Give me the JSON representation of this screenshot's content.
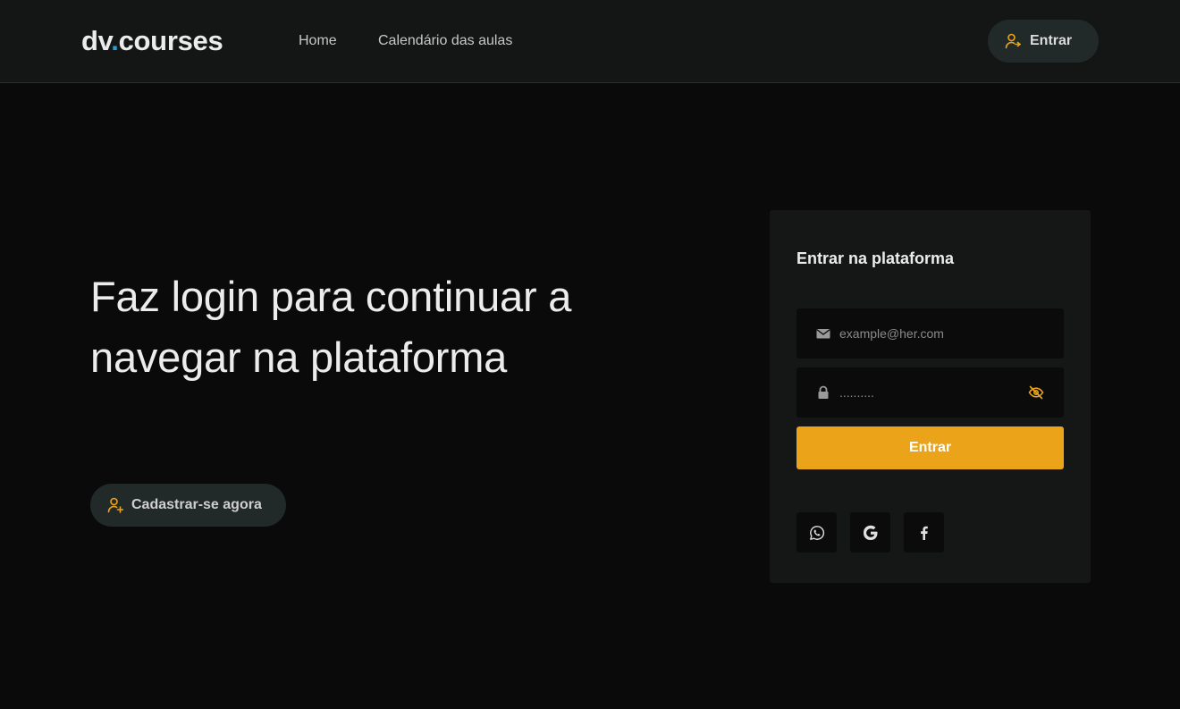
{
  "brand": {
    "name_part1": "dv",
    "name_dot": ".",
    "name_part2": "courses"
  },
  "nav": {
    "items": [
      {
        "label": "Home"
      },
      {
        "label": "Calendário das aulas"
      }
    ],
    "login_button": {
      "label": "Entrar",
      "icon": "user-login-icon"
    }
  },
  "hero": {
    "title": "Faz login para continuar a navegar na plataforma",
    "register_button": {
      "label": "Cadastrar-se agora",
      "icon": "user-add-icon"
    }
  },
  "login_card": {
    "title": "Entrar na plataforma",
    "email": {
      "placeholder": "example@her.com",
      "value": "",
      "icon": "envelope-icon"
    },
    "password": {
      "placeholder": "..........",
      "value": "",
      "icon": "lock-icon",
      "toggle_icon": "eye-slash-icon"
    },
    "submit_label": "Entrar",
    "social": [
      {
        "icon": "whatsapp-icon"
      },
      {
        "icon": "google-icon"
      },
      {
        "icon": "facebook-icon"
      }
    ]
  },
  "colors": {
    "accent": "#eba419",
    "brand_dot": "#2f9bd4",
    "background": "#0a0a0a",
    "header_bg": "#141515",
    "card_bg": "#151616"
  }
}
